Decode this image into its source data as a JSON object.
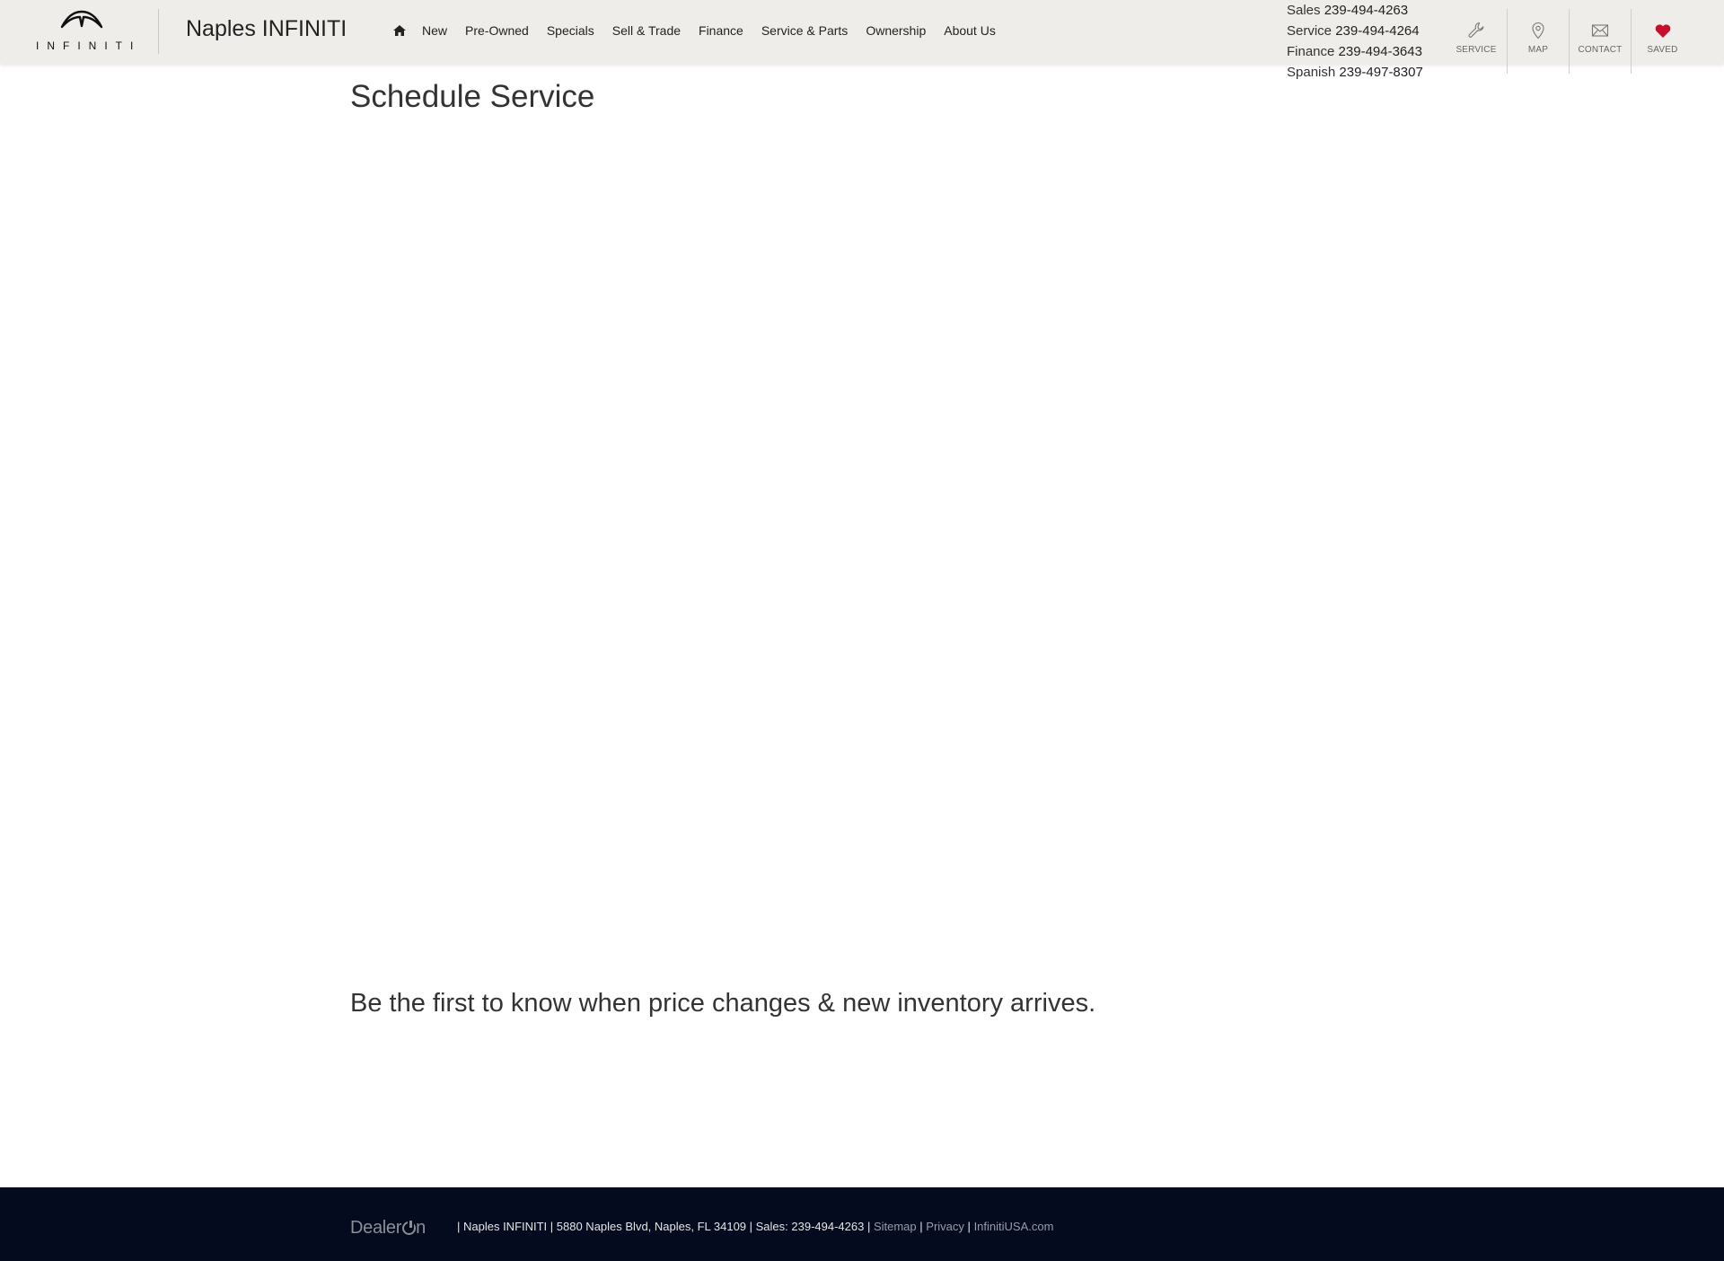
{
  "header": {
    "logo_text": "INFINITI",
    "dealer_name": "Naples INFINITI",
    "nav": [
      {
        "label": "New"
      },
      {
        "label": "Pre-Owned"
      },
      {
        "label": "Specials"
      },
      {
        "label": "Sell & Trade"
      },
      {
        "label": "Finance"
      },
      {
        "label": "Service & Parts"
      },
      {
        "label": "Ownership"
      },
      {
        "label": "About Us"
      }
    ],
    "phones": [
      {
        "label": "Sales",
        "number": "239-494-4263"
      },
      {
        "label": "Service",
        "number": "239-494-4264"
      },
      {
        "label": "Finance",
        "number": "239-494-3643"
      },
      {
        "label": "Spanish",
        "number": "239-497-8307"
      }
    ],
    "utility": [
      {
        "label": "SERVICE",
        "icon": "wrench-icon"
      },
      {
        "label": "MAP",
        "icon": "map-pin-icon"
      },
      {
        "label": "CONTACT",
        "icon": "envelope-icon"
      },
      {
        "label": "SAVED",
        "icon": "heart-icon"
      }
    ]
  },
  "main": {
    "title": "Schedule Service",
    "signup_heading": "Be the first to know when price changes & new inventory arrives."
  },
  "footer": {
    "brand": "DealerOn",
    "address_text": "| Naples INFINITI | 5880 Naples Blvd, Naples, FL 34109 | Sales: 239-494-4263 |",
    "links": [
      {
        "label": "Sitemap"
      },
      {
        "label": "Privacy"
      },
      {
        "label": "InfinitiUSA.com"
      }
    ],
    "separator": "|"
  },
  "colors": {
    "header_bg": "#eeedea",
    "footer_bg": "#050b1f",
    "saved_heart": "#c8102e"
  }
}
